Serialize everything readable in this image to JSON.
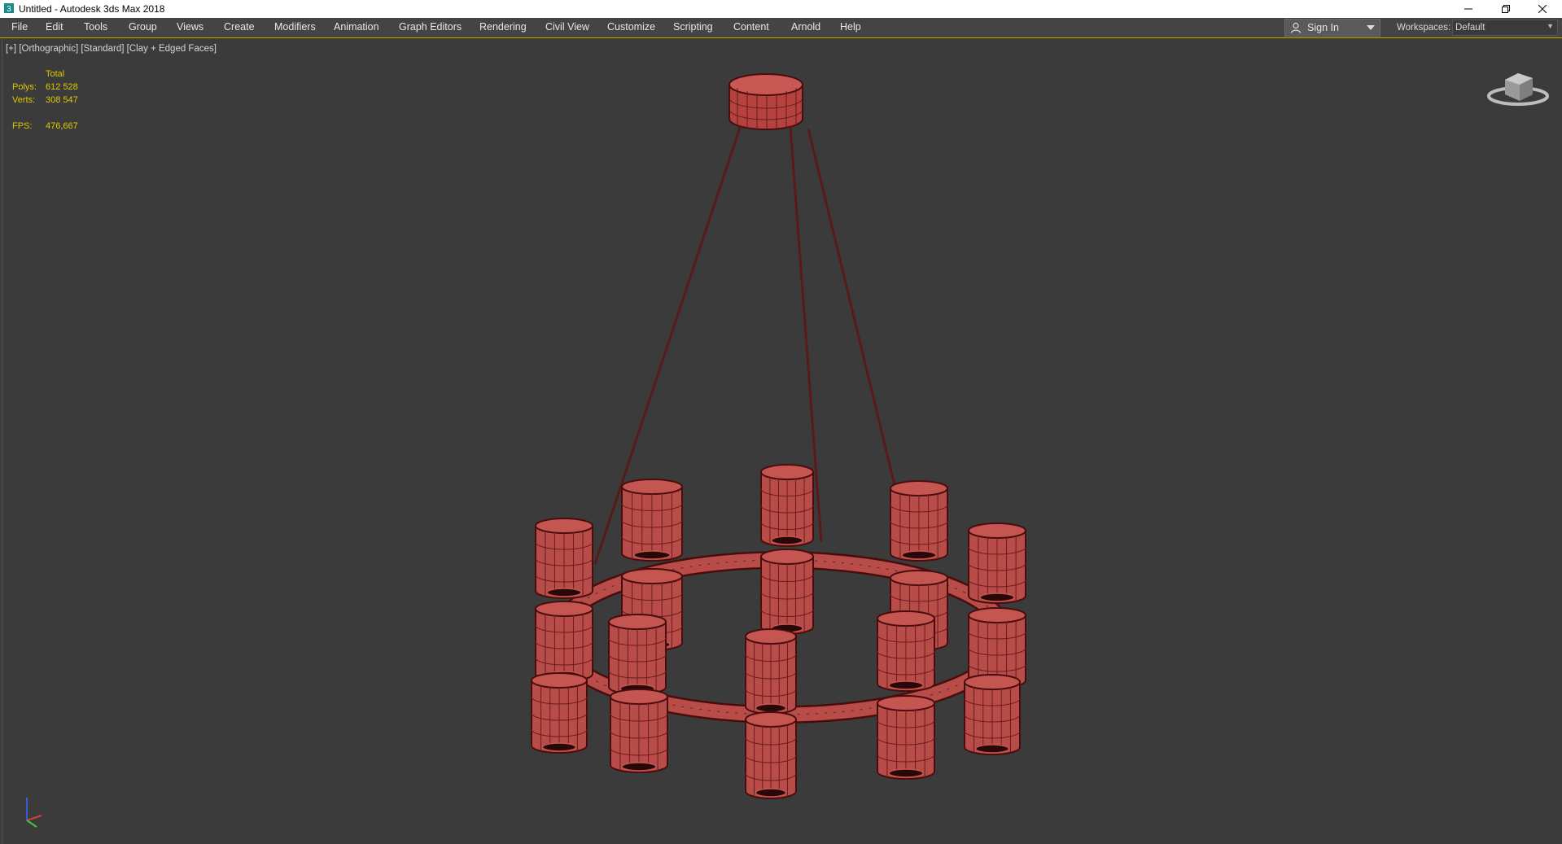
{
  "window": {
    "title": "Untitled - Autodesk 3ds Max 2018",
    "app_icon": "3dsmax-app-icon",
    "controls": [
      "minimize-icon",
      "restore-icon",
      "close-icon"
    ]
  },
  "menubar": {
    "items": [
      "File",
      "Edit",
      "Tools",
      "Group",
      "Views",
      "Create",
      "Modifiers",
      "Animation",
      "Graph Editors",
      "Rendering",
      "Civil View",
      "Customize",
      "Scripting",
      "Content",
      "Arnold",
      "Help"
    ]
  },
  "signin": {
    "label": "Sign In",
    "icon": "person-icon"
  },
  "workspaces": {
    "label": "Workspaces:",
    "value": "Default"
  },
  "viewport": {
    "labels": [
      "[+]",
      "[Orthographic]",
      "[Standard]",
      "[Clay + Edged Faces]"
    ],
    "stats": {
      "header": "Total",
      "polys_label": "Polys:",
      "polys_value": "612 528",
      "verts_label": "Verts:",
      "verts_value": "308 547",
      "fps_label": "FPS:",
      "fps_value": "476,667"
    },
    "viewcube_icon": "viewcube-icon",
    "axis_icon": "axis-tripod-icon",
    "model": "chandelier-model"
  },
  "colors": {
    "viewport_bg": "#3b3b3b",
    "menubar_bg": "#444444",
    "stats_text": "#e0c800",
    "model_fill": "#b84c48",
    "model_edge": "#4a0d0d"
  }
}
